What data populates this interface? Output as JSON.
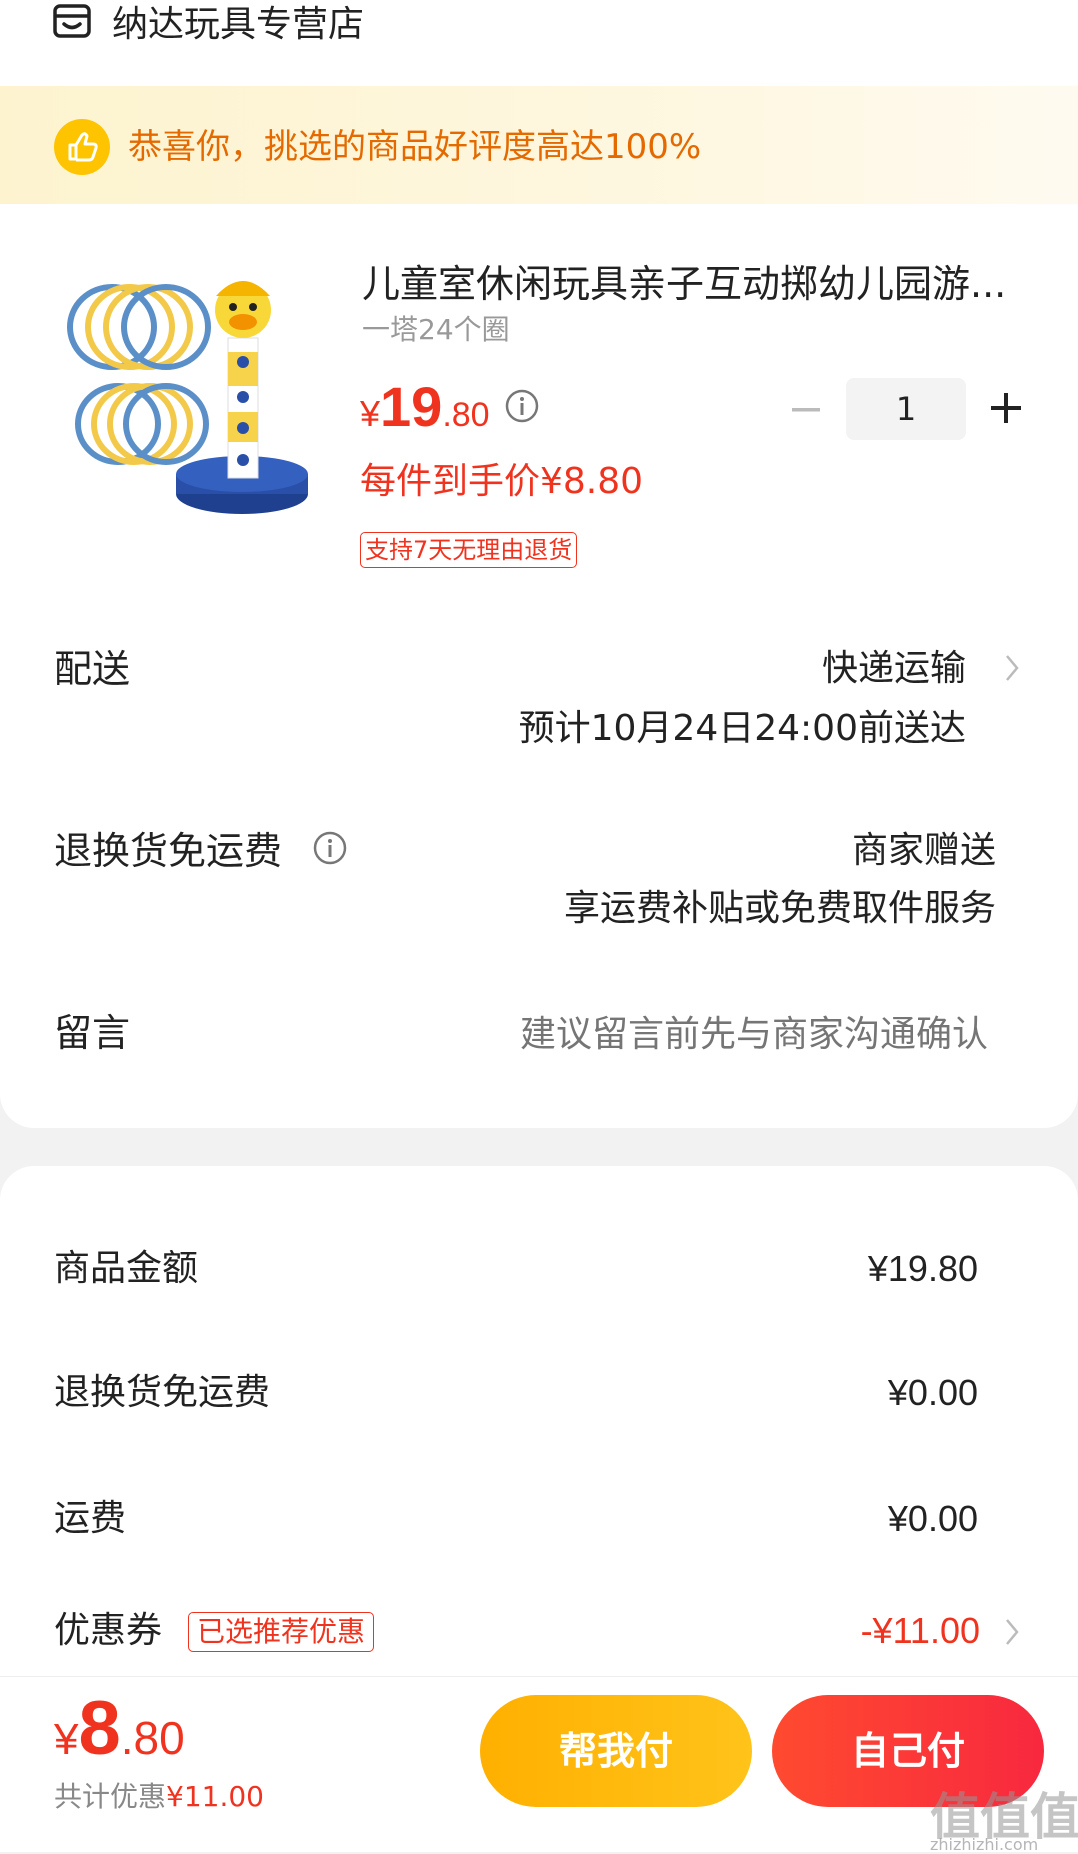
{
  "header": {
    "store_name": "纳达玩具专营店",
    "store_icon": "store-icon"
  },
  "banner": {
    "icon": "thumbs-up-icon",
    "text": "恭喜你，挑选的商品好评度高达100%",
    "text_color": "#e46a00"
  },
  "product": {
    "title": "儿童室休闲玩具亲子互动掷幼儿园游...",
    "sku": "一塔24个圈",
    "price_currency": "¥",
    "price_int": "19",
    "price_dec": ".80",
    "unit_price": "每件到手价¥8.80",
    "return_policy": "支持7天无理由退货",
    "quantity": "1",
    "image": "ring-toss-toy-image"
  },
  "delivery": {
    "label": "配送",
    "method": "快递运输",
    "eta": "预计10月24日24:00前送达"
  },
  "return_shipping": {
    "label": "退换货免运费",
    "provider": "商家赠送",
    "desc": "享运费补贴或免费取件服务"
  },
  "message": {
    "label": "留言",
    "placeholder": "建议留言前先与商家沟通确认"
  },
  "summary": {
    "goods_label": "商品金额",
    "goods_value": "¥19.80",
    "return_fee_label": "退换货免运费",
    "return_fee_value": "¥0.00",
    "shipping_label": "运费",
    "shipping_value": "¥0.00",
    "coupon_label": "优惠券",
    "coupon_badge": "已选推荐优惠",
    "coupon_value": "-¥11.00"
  },
  "footer": {
    "total_currency": "¥",
    "total_int": "8",
    "total_dec": ".80",
    "saving_label": "共计优惠",
    "saving_amount": "¥11.00",
    "help_pay": "帮我付",
    "self_pay": "自己付",
    "watermark": "值值值",
    "watermark_url": "zhizhizhi.com"
  },
  "colors": {
    "accent_red": "#f0331f",
    "help_btn": "#ffb000",
    "self_btn": "#f8283f"
  }
}
